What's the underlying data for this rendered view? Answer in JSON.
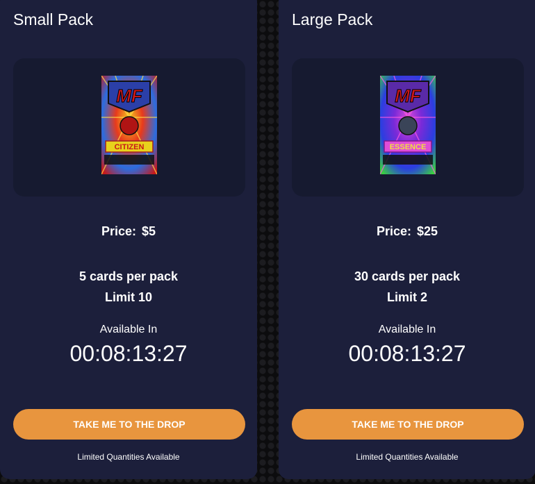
{
  "colors": {
    "card_bg": "#1c1f3b",
    "image_box_bg": "#161a30",
    "button": "#e8953e",
    "text": "#ffffff"
  },
  "packs": [
    {
      "title": "Small Pack",
      "image_icon": "citizen-pack-image",
      "image_logo": "MF",
      "image_banner": "CITIZEN",
      "price_label": "Price:",
      "price_value": "$5",
      "cards_per_pack": "5 cards per pack",
      "limit": "Limit 10",
      "available_label": "Available In",
      "countdown": "00:08:13:27",
      "button_label": "TAKE ME TO THE DROP",
      "note": "Limited Quantities Available"
    },
    {
      "title": "Large Pack",
      "image_icon": "essence-pack-image",
      "image_logo": "MF",
      "image_banner": "ESSENCE",
      "price_label": "Price:",
      "price_value": "$25",
      "cards_per_pack": "30 cards per pack",
      "limit": "Limit 2",
      "available_label": "Available In",
      "countdown": "00:08:13:27",
      "button_label": "TAKE ME TO THE DROP",
      "note": "Limited Quantities Available"
    }
  ]
}
